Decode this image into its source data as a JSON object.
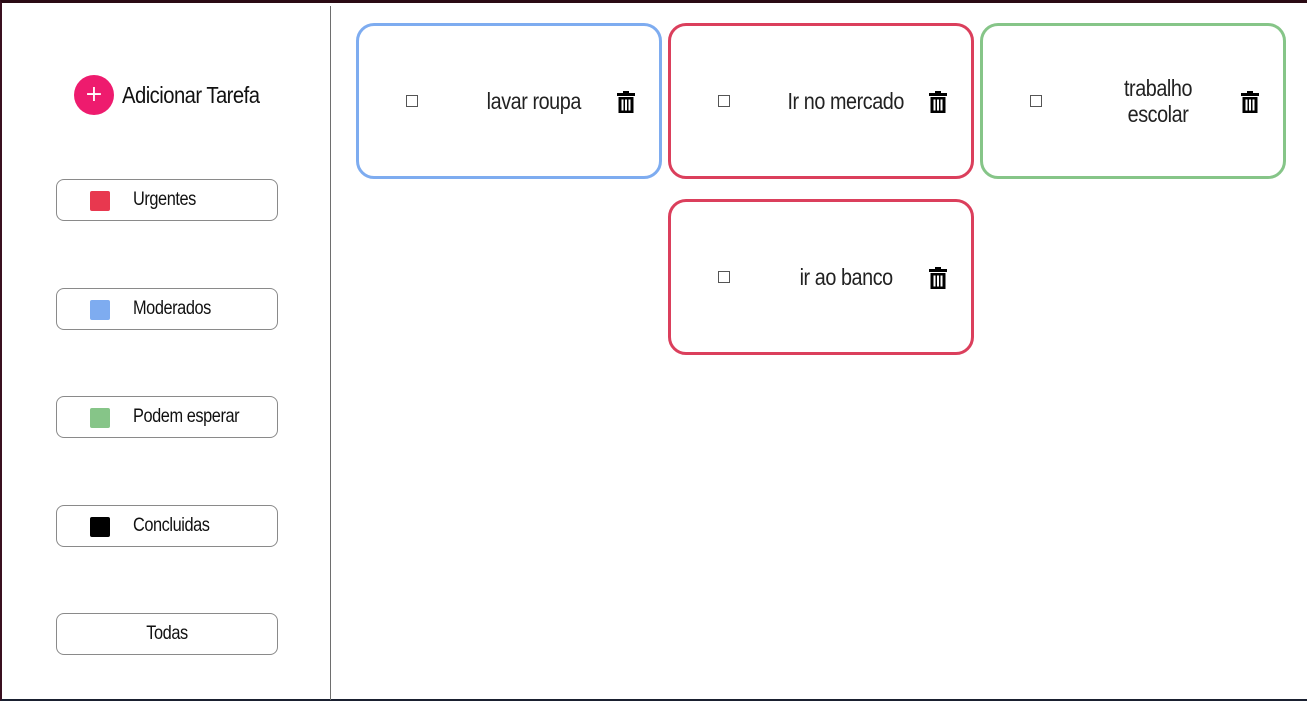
{
  "sidebar": {
    "add_task": {
      "icon": "+",
      "label": "Adicionar Tarefa"
    },
    "filters": [
      {
        "label": "Urgentes",
        "color": "#e8384f"
      },
      {
        "label": "Moderados",
        "color": "#7eacf0"
      },
      {
        "label": "Podem esperar",
        "color": "#86c588"
      },
      {
        "label": "Concluidas",
        "color": "#000000"
      },
      {
        "label": "Todas"
      }
    ]
  },
  "tasks": [
    {
      "text": "lavar roupa",
      "priority": "Moderados",
      "border_color": "#7eacf0",
      "done": false,
      "icon": "trash-icon"
    },
    {
      "text": "Ir no mercado",
      "priority": "Urgentes",
      "border_color": "#db3f5c",
      "done": false,
      "icon": "trash-icon"
    },
    {
      "text": "trabalho escolar",
      "priority": "Podem esperar",
      "border_color": "#86c588",
      "done": false,
      "icon": "trash-icon"
    },
    {
      "text": "ir ao banco",
      "priority": "Urgentes",
      "border_color": "#db3f5c",
      "done": false,
      "icon": "trash-icon"
    }
  ],
  "colors": {
    "accent": "#ee1b6e"
  }
}
